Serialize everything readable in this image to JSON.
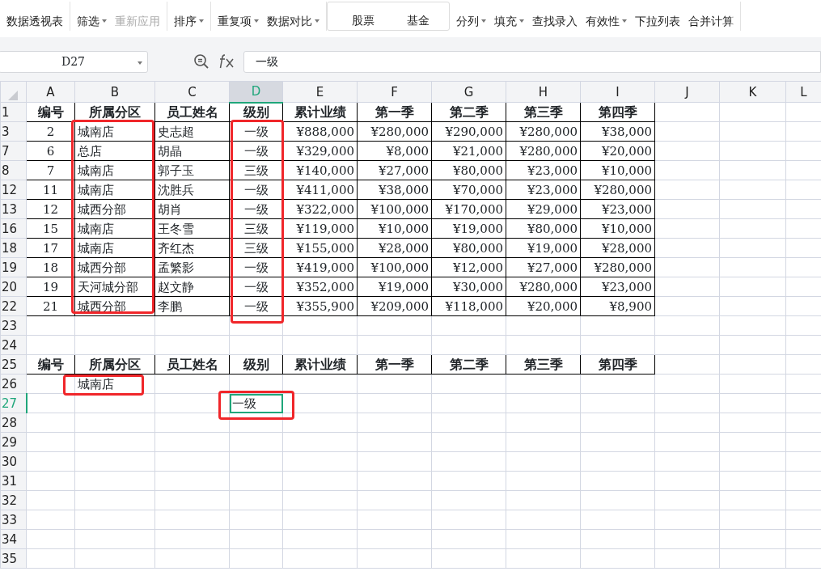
{
  "toolbar": {
    "groups": [
      {
        "items": [
          {
            "label": "数据透视表",
            "dropdown": false,
            "disabled": false
          }
        ]
      },
      {
        "items": [
          {
            "label": "筛选",
            "dropdown": true,
            "disabled": false
          },
          {
            "label": "重新应用",
            "dropdown": false,
            "disabled": true
          }
        ]
      },
      {
        "items": [
          {
            "label": "排序",
            "dropdown": true,
            "disabled": false
          }
        ]
      },
      {
        "items": [
          {
            "label": "重复项",
            "dropdown": true,
            "disabled": false
          },
          {
            "label": "数据对比",
            "dropdown": true,
            "disabled": false
          }
        ]
      },
      {
        "kind": "gallery",
        "items": [
          {
            "label": "股票",
            "dropdown": false,
            "disabled": false
          },
          {
            "label": "基金",
            "dropdown": false,
            "disabled": false
          }
        ]
      },
      {
        "items": [
          {
            "label": "分列",
            "dropdown": true,
            "disabled": false
          },
          {
            "label": "填充",
            "dropdown": true,
            "disabled": false
          },
          {
            "label": "查找录入",
            "dropdown": false,
            "disabled": false
          },
          {
            "label": "有效性",
            "dropdown": true,
            "disabled": false
          },
          {
            "label": "下拉列表",
            "dropdown": false,
            "disabled": false
          },
          {
            "label": "合并计算",
            "dropdown": false,
            "disabled": false
          }
        ]
      }
    ]
  },
  "formula_bar": {
    "name_box": "D27",
    "formula": "一级"
  },
  "columns": [
    {
      "label": "A",
      "selected": false
    },
    {
      "label": "B",
      "selected": false
    },
    {
      "label": "C",
      "selected": false
    },
    {
      "label": "D",
      "selected": true
    },
    {
      "label": "E",
      "selected": false
    },
    {
      "label": "F",
      "selected": false
    },
    {
      "label": "G",
      "selected": false
    },
    {
      "label": "H",
      "selected": false
    },
    {
      "label": "I",
      "selected": false
    },
    {
      "label": "J",
      "selected": false
    },
    {
      "label": "K",
      "selected": false
    },
    {
      "label": "L",
      "selected": false
    }
  ],
  "rows": [
    {
      "header": "1",
      "kind": "header",
      "selected": false,
      "cells": [
        "编号",
        "所属分区",
        "员工姓名",
        "级别",
        "累计业绩",
        "第一季",
        "第二季",
        "第三季",
        "第四季"
      ]
    },
    {
      "header": "3",
      "kind": "data",
      "selected": false,
      "cells": [
        "2",
        "城南店",
        "史志超",
        "一级",
        "¥888,000",
        "¥280,000",
        "¥290,000",
        "¥280,000",
        "¥38,000"
      ]
    },
    {
      "header": "7",
      "kind": "data",
      "selected": false,
      "cells": [
        "6",
        "总店",
        "胡晶",
        "一级",
        "¥329,000",
        "¥8,000",
        "¥21,000",
        "¥280,000",
        "¥20,000"
      ]
    },
    {
      "header": "8",
      "kind": "data",
      "selected": false,
      "cells": [
        "7",
        "城南店",
        "郭子玉",
        "三级",
        "¥140,000",
        "¥27,000",
        "¥80,000",
        "¥23,000",
        "¥10,000"
      ]
    },
    {
      "header": "12",
      "kind": "data",
      "selected": false,
      "cells": [
        "11",
        "城南店",
        "沈胜兵",
        "一级",
        "¥411,000",
        "¥38,000",
        "¥70,000",
        "¥23,000",
        "¥280,000"
      ]
    },
    {
      "header": "13",
      "kind": "data",
      "selected": false,
      "cells": [
        "12",
        "城西分部",
        "胡肖",
        "一级",
        "¥322,000",
        "¥100,000",
        "¥170,000",
        "¥29,000",
        "¥23,000"
      ]
    },
    {
      "header": "16",
      "kind": "data",
      "selected": false,
      "cells": [
        "15",
        "城南店",
        "王冬雪",
        "三级",
        "¥119,000",
        "¥10,000",
        "¥19,000",
        "¥80,000",
        "¥10,000"
      ]
    },
    {
      "header": "18",
      "kind": "data",
      "selected": false,
      "cells": [
        "17",
        "城南店",
        "齐红杰",
        "三级",
        "¥155,000",
        "¥28,000",
        "¥80,000",
        "¥19,000",
        "¥28,000"
      ]
    },
    {
      "header": "19",
      "kind": "data",
      "selected": false,
      "cells": [
        "18",
        "城西分部",
        "孟繁影",
        "一级",
        "¥419,000",
        "¥100,000",
        "¥12,000",
        "¥27,000",
        "¥280,000"
      ]
    },
    {
      "header": "20",
      "kind": "data",
      "selected": false,
      "cells": [
        "19",
        "天河城分部",
        "赵文静",
        "一级",
        "¥352,000",
        "¥19,000",
        "¥30,000",
        "¥280,000",
        "¥23,000"
      ]
    },
    {
      "header": "22",
      "kind": "data",
      "selected": false,
      "cells": [
        "21",
        "城西分部",
        "李鹏",
        "一级",
        "¥355,900",
        "¥209,000",
        "¥118,000",
        "¥20,000",
        "¥8,900"
      ]
    },
    {
      "header": "23",
      "kind": "blank",
      "selected": false
    },
    {
      "header": "24",
      "kind": "blank",
      "selected": false
    },
    {
      "header": "25",
      "kind": "header",
      "selected": false,
      "cells": [
        "编号",
        "所属分区",
        "员工姓名",
        "级别",
        "累计业绩",
        "第一季",
        "第二季",
        "第三季",
        "第四季"
      ]
    },
    {
      "header": "26",
      "kind": "input",
      "selected": false,
      "cells": [
        null,
        "城南店"
      ]
    },
    {
      "header": "27",
      "kind": "input",
      "selected": true,
      "cells": [
        null,
        null,
        null,
        "一级"
      ]
    },
    {
      "header": "28",
      "kind": "blank",
      "selected": false
    },
    {
      "header": "29",
      "kind": "blank",
      "selected": false
    },
    {
      "header": "30",
      "kind": "blank",
      "selected": false
    },
    {
      "header": "31",
      "kind": "blank",
      "selected": false
    },
    {
      "header": "32",
      "kind": "blank",
      "selected": false
    },
    {
      "header": "33",
      "kind": "blank",
      "selected": false
    },
    {
      "header": "34",
      "kind": "blank",
      "selected": false
    },
    {
      "header": "35",
      "kind": "blank",
      "selected": false
    }
  ]
}
